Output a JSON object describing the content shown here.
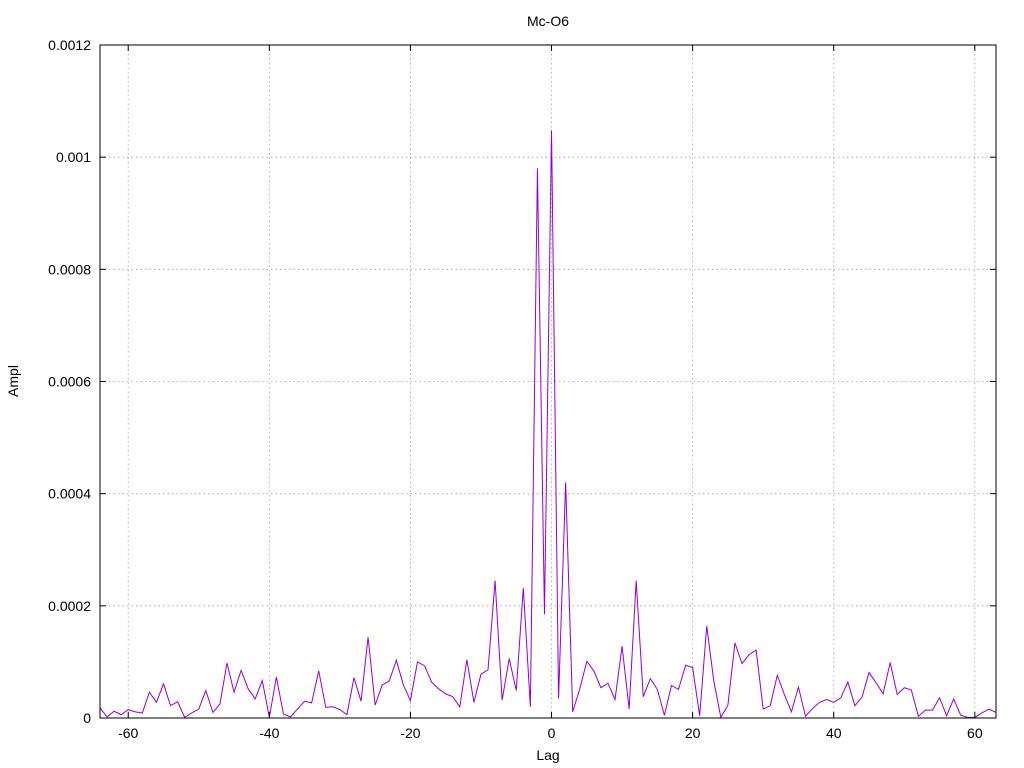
{
  "chart_data": {
    "type": "line",
    "title": "Mc-O6",
    "xlabel": "Lag",
    "ylabel": "Ampl",
    "xlim": [
      -64,
      63
    ],
    "ylim": [
      0,
      0.0012
    ],
    "grid": true,
    "x_ticks": [
      -60,
      -40,
      -20,
      0,
      20,
      40,
      60
    ],
    "x_tick_labels": [
      "-60",
      "-40",
      "-20",
      "0",
      "20",
      "40",
      "60"
    ],
    "y_ticks": [
      0,
      0.0002,
      0.0004,
      0.0006,
      0.0008,
      0.001,
      0.0012
    ],
    "y_tick_labels": [
      "0",
      "0.0002",
      "0.0004",
      "0.0006",
      "0.0008",
      "0.001",
      "0.0012"
    ],
    "series": [
      {
        "color": "#9400d3",
        "x": [
          -64,
          -63,
          -62,
          -61,
          -60,
          -59,
          -58,
          -57,
          -56,
          -55,
          -54,
          -53,
          -52,
          -51,
          -50,
          -49,
          -48,
          -47,
          -46,
          -45,
          -44,
          -43,
          -42,
          -41,
          -40,
          -39,
          -38,
          -37,
          -36,
          -35,
          -34,
          -33,
          -32,
          -31,
          -30,
          -29,
          -28,
          -27,
          -26,
          -25,
          -24,
          -23,
          -22,
          -21,
          -20,
          -19,
          -18,
          -17,
          -16,
          -15,
          -14,
          -13,
          -12,
          -11,
          -10,
          -9,
          -8,
          -7,
          -6,
          -5,
          -4,
          -3,
          -2,
          -1,
          0,
          1,
          2,
          3,
          4,
          5,
          6,
          7,
          8,
          9,
          10,
          11,
          12,
          13,
          14,
          15,
          16,
          17,
          18,
          19,
          20,
          21,
          22,
          23,
          24,
          25,
          26,
          27,
          28,
          29,
          30,
          31,
          32,
          33,
          34,
          35,
          36,
          37,
          38,
          39,
          40,
          41,
          42,
          43,
          44,
          45,
          46,
          47,
          48,
          49,
          50,
          51,
          52,
          53,
          54,
          55,
          56,
          57,
          58,
          59,
          60,
          61,
          62,
          63
        ],
        "y": [
          1.8e-05,
          2e-06,
          1.2e-05,
          6e-06,
          1.5e-05,
          1.1e-05,
          9e-06,
          4.6e-05,
          2.8e-05,
          6.1e-05,
          2.2e-05,
          2.9e-05,
          1e-06,
          9e-06,
          1.6e-05,
          4.9e-05,
          1e-05,
          2.5e-05,
          9.8e-05,
          4.6e-05,
          8.5e-05,
          5.2e-05,
          3.4e-05,
          6.7e-05,
          1e-06,
          7.3e-05,
          7e-06,
          2e-06,
          1.6e-05,
          3e-05,
          2.7e-05,
          8.4e-05,
          1.9e-05,
          2e-05,
          1.5e-05,
          6e-06,
          7.2e-05,
          3e-05,
          0.000144,
          2.3e-05,
          5.9e-05,
          6.6e-05,
          0.000103,
          5.9e-05,
          3.1e-05,
          0.0001,
          9.3e-05,
          6.4e-05,
          5.2e-05,
          4.3e-05,
          3.8e-05,
          2e-05,
          0.000104,
          2.8e-05,
          7.8e-05,
          8.6e-05,
          0.000245,
          3.2e-05,
          0.000106,
          4.9e-05,
          0.000232,
          2e-05,
          0.00098,
          0.000185,
          0.001048,
          3.5e-05,
          0.00042,
          1.1e-05,
          5.2e-05,
          0.000101,
          8.4e-05,
          5.4e-05,
          6.2e-05,
          3.3e-05,
          0.000128,
          1.6e-05,
          0.000245,
          3.8e-05,
          7e-05,
          5.1e-05,
          5e-06,
          5.8e-05,
          5.1e-05,
          9.4e-05,
          9e-05,
          4e-06,
          0.000164,
          6.6e-05,
          1e-06,
          2.3e-05,
          0.000134,
          9.7e-05,
          0.000113,
          0.000121,
          1.6e-05,
          2.2e-05,
          7.6e-05,
          4.2e-05,
          1.1e-05,
          5.5e-05,
          3e-06,
          1.7e-05,
          2.8e-05,
          3.3e-05,
          2.8e-05,
          3.6e-05,
          6.4e-05,
          2.2e-05,
          3.7e-05,
          8.1e-05,
          6.3e-05,
          4.3e-05,
          9.9e-05,
          4.2e-05,
          5.4e-05,
          5e-05,
          3e-06,
          1.4e-05,
          1.4e-05,
          3.6e-05,
          4e-06,
          3.4e-05,
          5e-06,
          1e-06,
          1e-06,
          9e-06,
          1.6e-05,
          1e-05
        ]
      }
    ]
  }
}
